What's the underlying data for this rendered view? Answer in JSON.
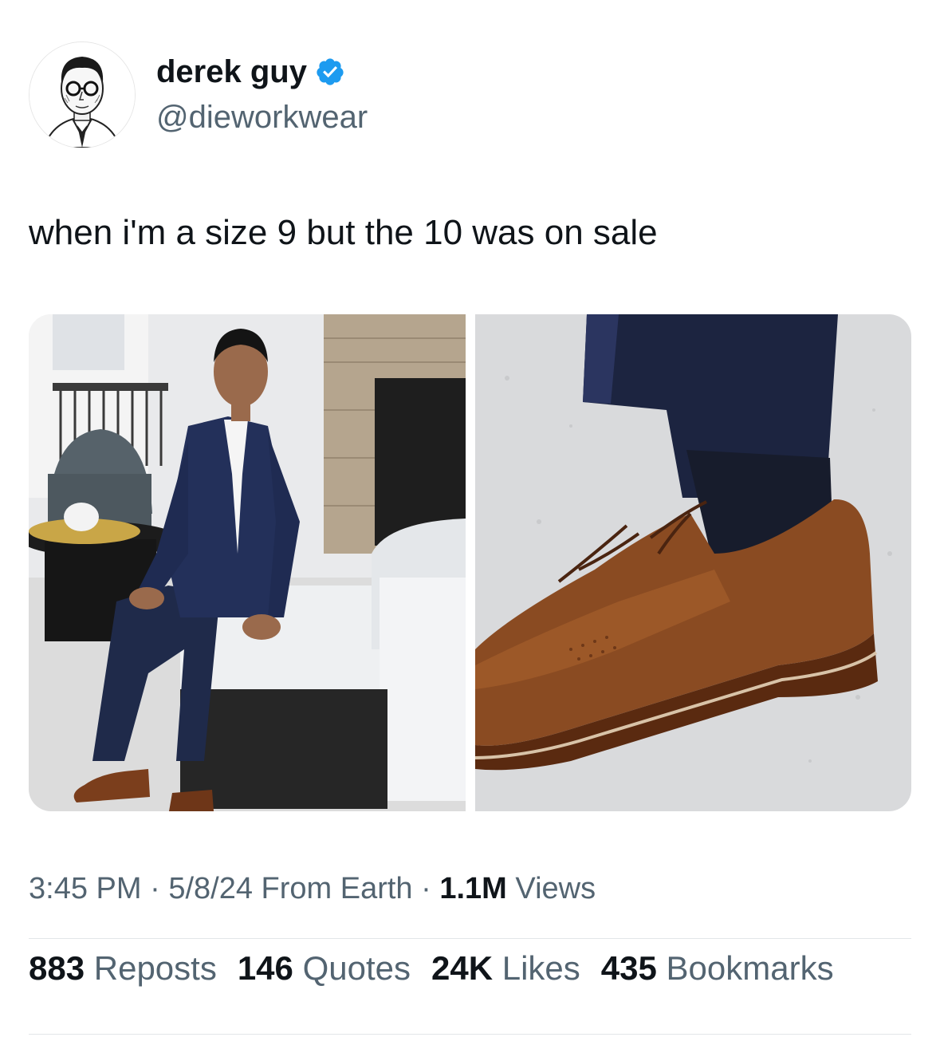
{
  "tweet": {
    "author": {
      "display_name": "derek guy",
      "handle": "@dieworkwear",
      "verified": true,
      "verified_color": "#1d9bf0"
    },
    "text": "when i'm a size 9 but the 10 was on sale",
    "media": [
      {
        "alt_icon": "man-in-suit-photo"
      },
      {
        "alt_icon": "brown-shoe-closeup-photo"
      }
    ],
    "meta": {
      "time": "3:45 PM",
      "sep1": "·",
      "date": "5/8/24",
      "source": "From Earth",
      "sep2": "·",
      "views_count": "1.1M",
      "views_label": "Views"
    },
    "stats": {
      "reposts_count": "883",
      "reposts_label": "Reposts",
      "quotes_count": "146",
      "quotes_label": "Quotes",
      "likes_count": "24K",
      "likes_label": "Likes",
      "bookmarks_count": "435",
      "bookmarks_label": "Bookmarks"
    }
  }
}
